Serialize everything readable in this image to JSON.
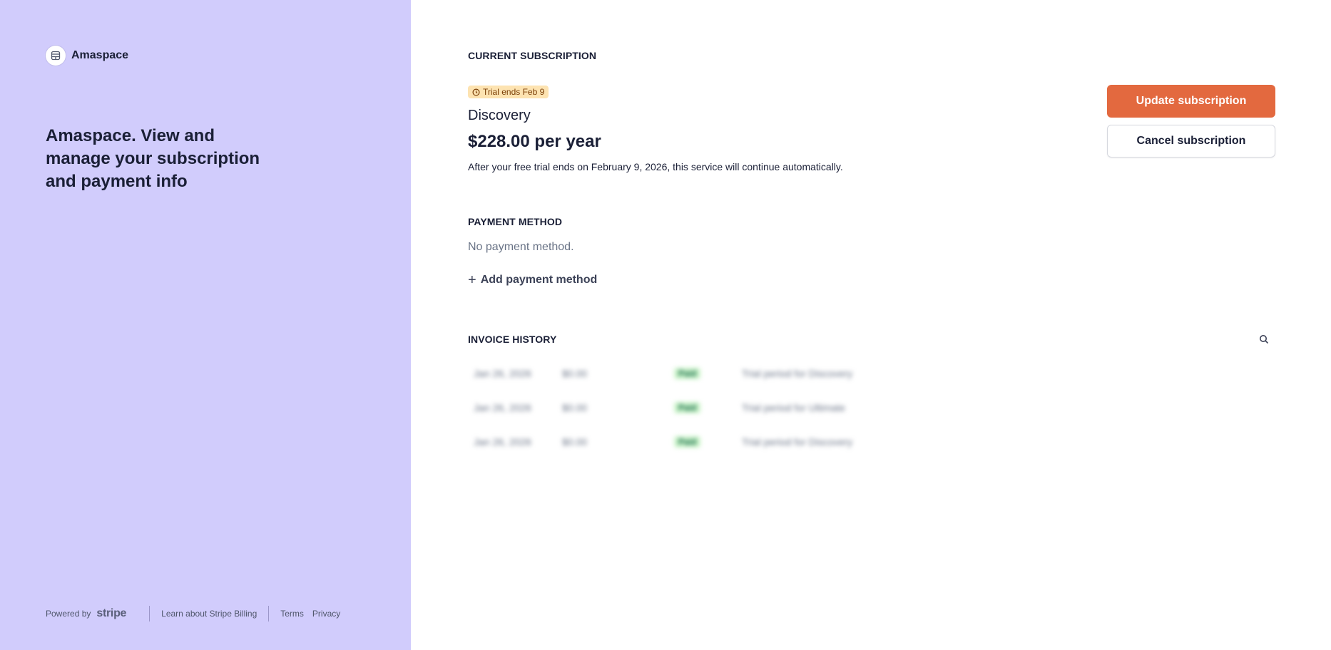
{
  "brand": {
    "name": "Amaspace",
    "logo_icon": "storefront-icon"
  },
  "headline": "Amaspace. View and manage your subscription and payment info",
  "footer": {
    "powered_by": "Powered by",
    "stripe": "stripe",
    "learn_more": "Learn about Stripe Billing",
    "terms": "Terms",
    "privacy": "Privacy"
  },
  "subscription": {
    "section_title": "CURRENT SUBSCRIPTION",
    "badge": "Trial ends Feb 9",
    "plan_name": "Discovery",
    "price": "$228.00 per year",
    "note": "After your free trial ends on February 9, 2026, this service will continue automatically.",
    "update_label": "Update subscription",
    "cancel_label": "Cancel subscription"
  },
  "payment": {
    "section_title": "PAYMENT METHOD",
    "empty_text": "No payment method.",
    "add_label": "Add payment method"
  },
  "invoices": {
    "section_title": "INVOICE HISTORY",
    "rows": [
      {
        "date": "Jan 26, 2026",
        "amount": "$0.00",
        "status": "Paid",
        "description": "Trial period for Discovery"
      },
      {
        "date": "Jan 26, 2026",
        "amount": "$0.00",
        "status": "Paid",
        "description": "Trial period for Ultimate"
      },
      {
        "date": "Jan 26, 2026",
        "amount": "$0.00",
        "status": "Paid",
        "description": "Trial period for Discovery"
      }
    ]
  },
  "colors": {
    "sidebar_bg": "#d1ccfc",
    "primary_button": "#e3693f",
    "badge_bg": "#fde3b1",
    "paid_badge_bg": "#cbf4c9"
  }
}
